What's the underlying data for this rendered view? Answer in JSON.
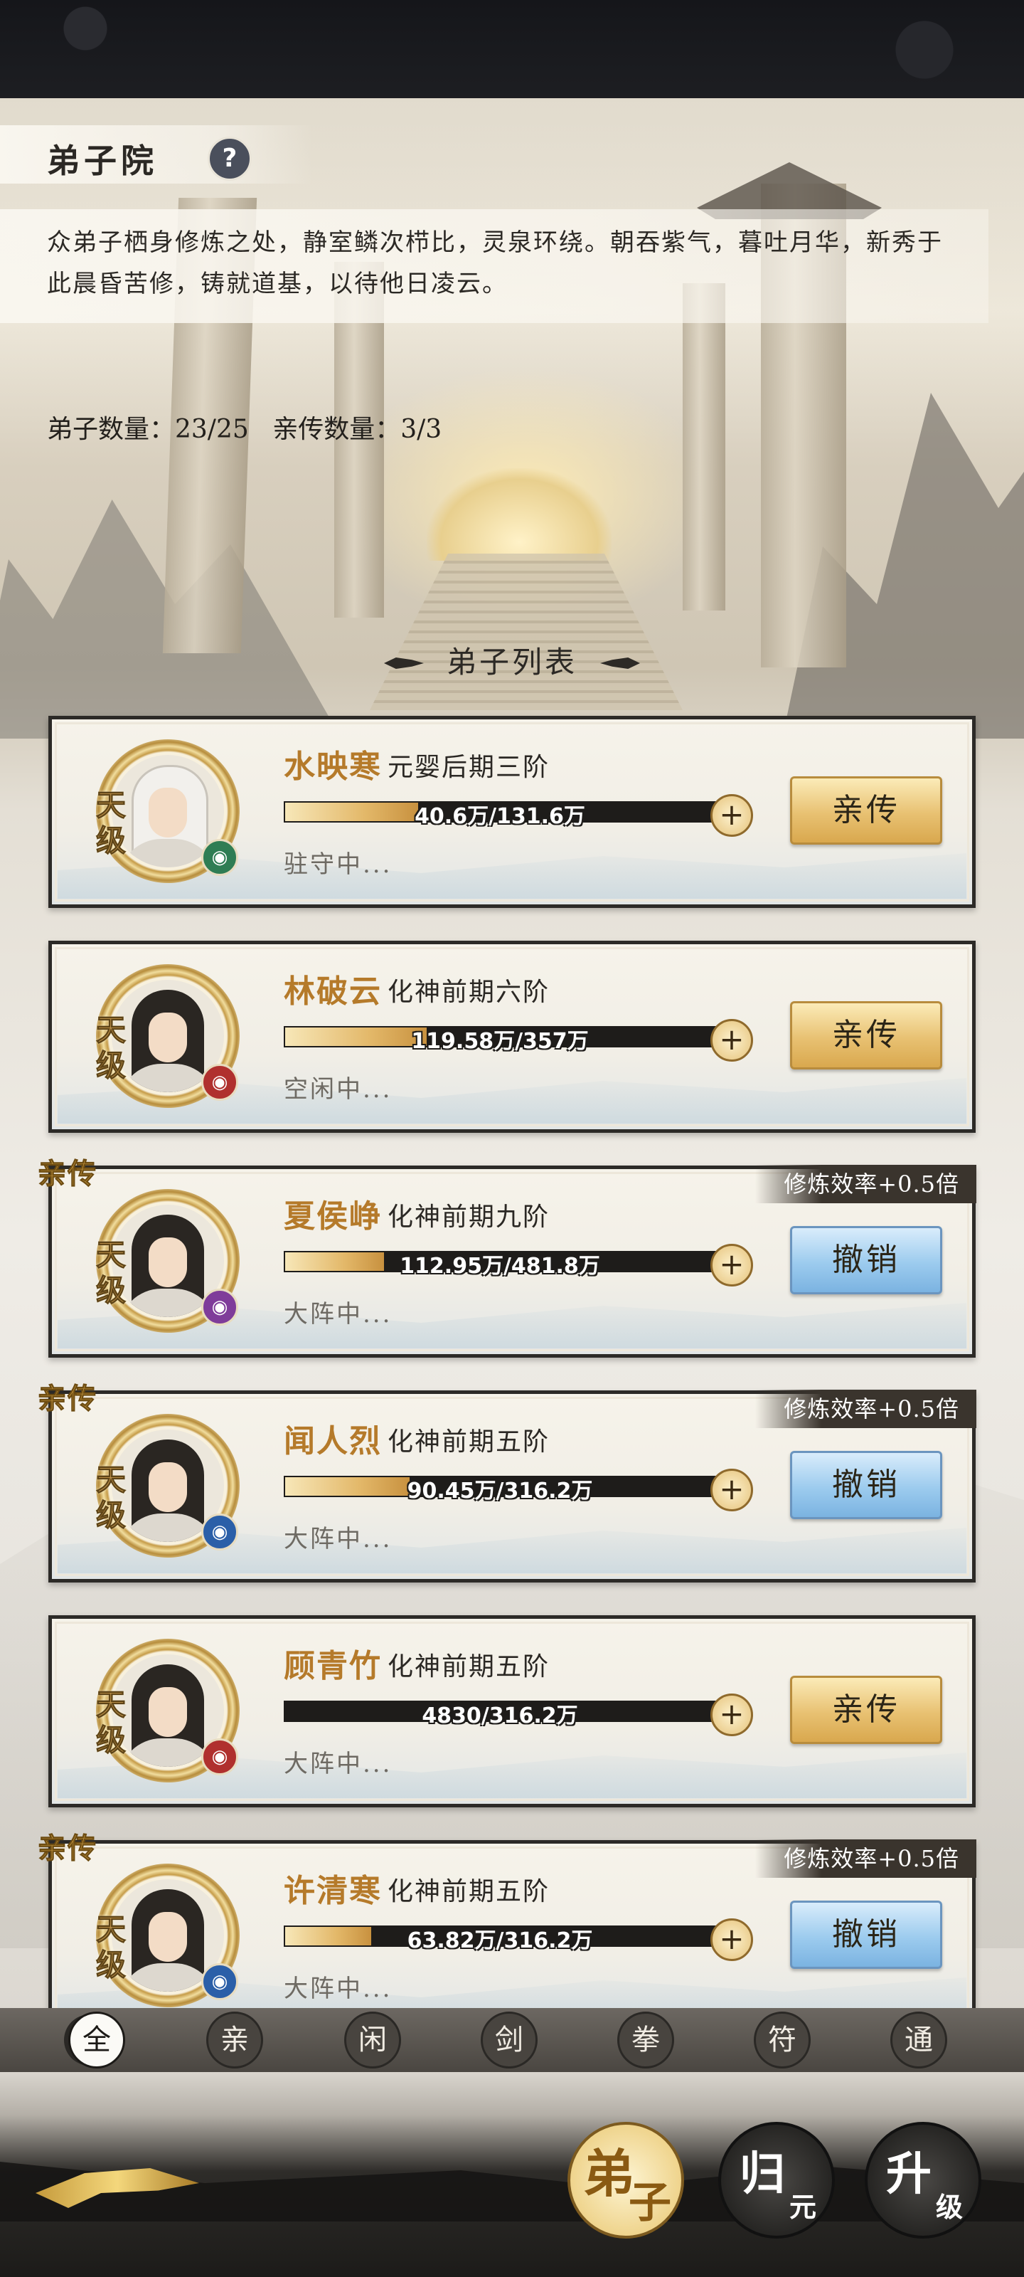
{
  "header": {
    "title": "弟子院",
    "help_icon": "?",
    "description": "众弟子栖身修炼之处，静室鳞次栉比，灵泉环绕。朝吞紫气，暮吐月华，新秀于此晨昏苦修，铸就道基，以待他日凌云。",
    "disciple_count": "弟子数量：23/25",
    "core_count": "亲传数量：3/3"
  },
  "list": {
    "title": "弟子列表",
    "grade_label": "天级",
    "core_tag": "亲传",
    "rate_tag": "修炼效率+0.5倍",
    "disciples": [
      {
        "name": "水映寒",
        "realm": "元婴后期三阶",
        "exp": "40.6万/131.6万",
        "progress": 0.31,
        "status": "驻守中...",
        "action": "亲传",
        "core": false,
        "element": "water-swirl-icon",
        "element_color": "#2f7d54"
      },
      {
        "name": "林破云",
        "realm": "化神前期六阶",
        "exp": "119.58万/357万",
        "progress": 0.33,
        "status": "空闲中...",
        "action": "亲传",
        "core": false,
        "element": "fist-icon",
        "element_color": "#b0302e"
      },
      {
        "name": "夏侯峥",
        "realm": "化神前期九阶",
        "exp": "112.95万/481.8万",
        "progress": 0.23,
        "status": "大阵中...",
        "action": "撤销",
        "core": true,
        "element": "vortex-icon",
        "element_color": "#7f3c9a"
      },
      {
        "name": "闻人烈",
        "realm": "化神前期五阶",
        "exp": "90.45万/316.2万",
        "progress": 0.29,
        "status": "大阵中...",
        "action": "撤销",
        "core": true,
        "element": "sword-icon",
        "element_color": "#2b5fa8"
      },
      {
        "name": "顾青竹",
        "realm": "化神前期五阶",
        "exp": "4830/316.2万",
        "progress": 0.0,
        "status": "大阵中...",
        "action": "亲传",
        "core": false,
        "element": "fist-icon",
        "element_color": "#b0302e"
      },
      {
        "name": "许清寒",
        "realm": "化神前期五阶",
        "exp": "63.82万/316.2万",
        "progress": 0.2,
        "status": "大阵中...",
        "action": "撤销",
        "core": true,
        "element": "sword-icon",
        "element_color": "#2b5fa8"
      }
    ]
  },
  "filters": [
    {
      "label": "全",
      "active": true
    },
    {
      "label": "亲",
      "active": false
    },
    {
      "label": "闲",
      "active": false
    },
    {
      "label": "剑",
      "active": false
    },
    {
      "label": "拳",
      "active": false
    },
    {
      "label": "符",
      "active": false
    },
    {
      "label": "通",
      "active": false
    }
  ],
  "bottom_nav": [
    {
      "big": "弟",
      "small": "子",
      "active": true
    },
    {
      "big": "归",
      "small": "元",
      "active": false
    },
    {
      "big": "升",
      "small": "级",
      "active": false
    }
  ]
}
